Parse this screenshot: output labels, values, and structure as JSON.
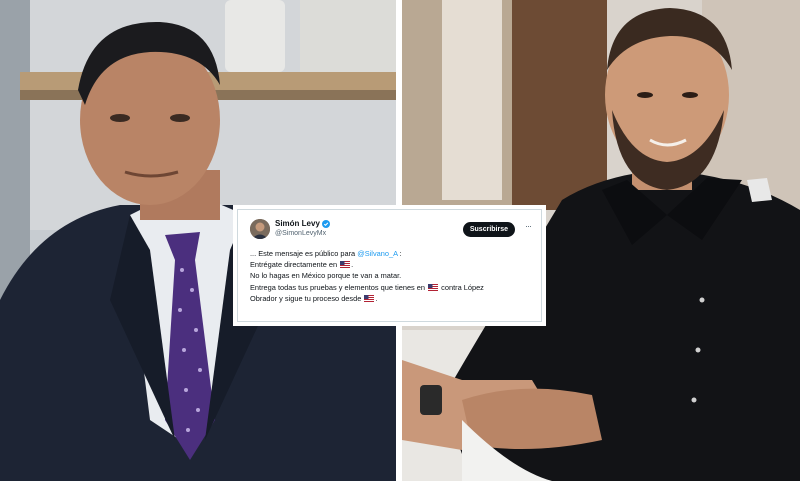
{
  "tweet": {
    "display_name": "Simón Levy",
    "handle": "@SimonLevyMx",
    "follow_label": "Suscribirse",
    "more_label": "···",
    "line1_prefix": "... Este mensaje es público para ",
    "line1_mention": "@Silvano_A",
    "line1_suffix": " :",
    "line2_text": "Entrégate directamente en ",
    "line2_end": ".",
    "line3_text": "No lo hagas en México porque te van a matar.",
    "line4_text": "Entrega todas tus pruebas y elementos que tienes en ",
    "line4_after": " contra López",
    "line5_text": "Obrador y sigue tu proceso desde ",
    "line5_end": ".",
    "flag_icon": "us-flag-icon",
    "verified_icon": "verified-badge-icon",
    "accent_color": "#1d9bf0"
  }
}
